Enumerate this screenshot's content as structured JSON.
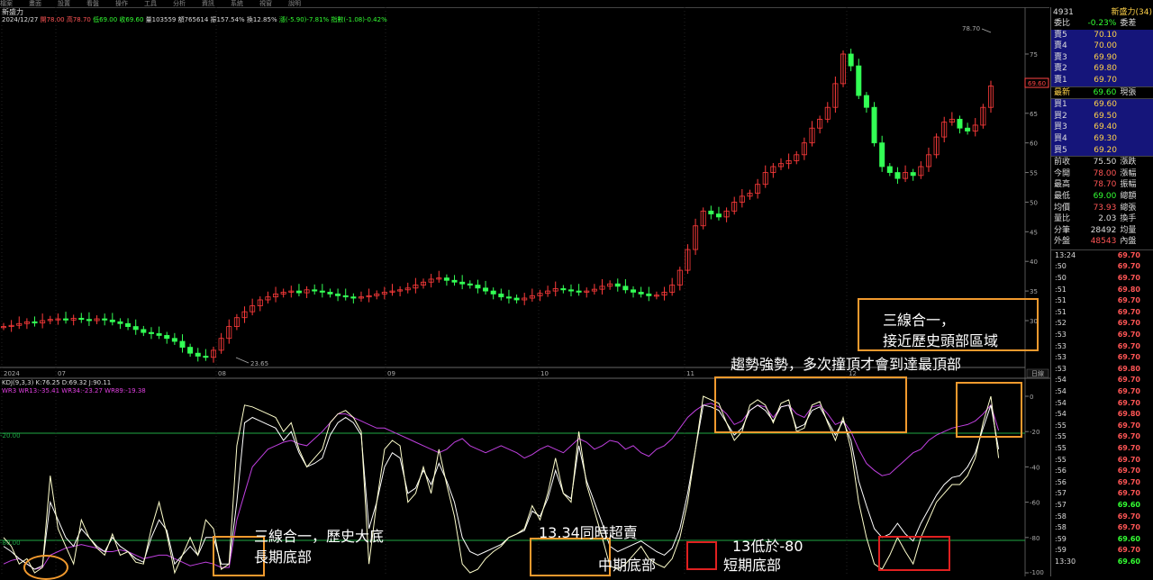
{
  "menu": [
    "檔案",
    "畫面",
    "設置",
    "看盤",
    "操作",
    "工具",
    "分析",
    "資訊",
    "系統",
    "視窗",
    "說明"
  ],
  "stock_title": "新盛力",
  "price_info": [
    {
      "text": "2024/12/27",
      "color": "w"
    },
    {
      "text": "開78.00",
      "color": "r"
    },
    {
      "text": "高78.70",
      "color": "r"
    },
    {
      "text": "低69.00",
      "color": "g"
    },
    {
      "text": "收69.60",
      "color": "g"
    },
    {
      "text": "量103559",
      "color": "w"
    },
    {
      "text": "額765614",
      "color": "w"
    },
    {
      "text": "振157.54%",
      "color": "w"
    },
    {
      "text": "換12.85%",
      "color": "w"
    },
    {
      "text": "漲(-5.90)-7.81%",
      "color": "g"
    },
    {
      "text": "指數(-1.08)-0.42%",
      "color": "g"
    }
  ],
  "kdj_line": "KDJ(9,3,3) K:76.25 D:69.32 J:90.11",
  "wr_line": "WR3 WR13:-35.41 WR34:-23.27 WR89:-19.38",
  "kline_max_label": "78.70",
  "kline_min_label": "23.65",
  "last_price_tag": "69.60",
  "price_axis": [
    "75",
    "70",
    "65",
    "60",
    "55",
    "50",
    "45",
    "40",
    "35",
    "30"
  ],
  "ind_axis": [
    "0",
    "-20",
    "-40",
    "-60",
    "-80",
    "-100"
  ],
  "ind_left_labels": [
    "-20.00",
    "-80.00"
  ],
  "date_axis": [
    "2024",
    "07",
    "08",
    "09",
    "10",
    "11",
    "12"
  ],
  "period_tab": "日線",
  "annotations": {
    "head_area": "三線合一，\n接近歷史頭部區域",
    "trend": "趨勢強勢，多次撞頂才會到達最頂部",
    "long_bottom": "三線合一，歷史大底\n長期底部",
    "mid_oversold": "13.34同時超賣",
    "mid_bottom": "中期底部",
    "short_cond": "13低於-80",
    "short_bottom": "短期底部"
  },
  "panel": {
    "code": "4931",
    "name": "新盛力",
    "name_suffix": "(34)",
    "ratio_label": "委比",
    "ratio_value": "-0.23%",
    "ratio_right": "委差",
    "asks": [
      {
        "label": "賣5",
        "value": "70.10"
      },
      {
        "label": "賣4",
        "value": "70.00"
      },
      {
        "label": "賣3",
        "value": "69.90"
      },
      {
        "label": "賣2",
        "value": "69.80"
      },
      {
        "label": "賣1",
        "value": "69.70"
      }
    ],
    "last": {
      "label": "最新",
      "value": "69.60",
      "right": "現張"
    },
    "bids": [
      {
        "label": "買1",
        "value": "69.60"
      },
      {
        "label": "買2",
        "value": "69.50"
      },
      {
        "label": "買3",
        "value": "69.40"
      },
      {
        "label": "買4",
        "value": "69.30"
      },
      {
        "label": "買5",
        "value": "69.20"
      }
    ],
    "stats": [
      {
        "label": "前收",
        "value": "75.50",
        "right": "漲跌",
        "color": "#ddd"
      },
      {
        "label": "今開",
        "value": "78.00",
        "right": "漲幅",
        "color": "#ff5555"
      },
      {
        "label": "最高",
        "value": "78.70",
        "right": "振幅",
        "color": "#ff5555"
      },
      {
        "label": "最低",
        "value": "69.00",
        "right": "總額",
        "color": "#33ff33"
      },
      {
        "label": "均價",
        "value": "73.93",
        "right": "總張",
        "color": "#ff5555"
      },
      {
        "label": "量比",
        "value": "2.03",
        "right": "換手",
        "color": "#ddd"
      },
      {
        "label": "分筆",
        "value": "28492",
        "right": "均量",
        "color": "#ddd"
      },
      {
        "label": "外盤",
        "value": "48543",
        "right": "內盤",
        "color": "#ff5555"
      }
    ],
    "ticks": [
      {
        "time": "13:24",
        "price": "69.70",
        "color": "#ff5555"
      },
      {
        "time": ":50",
        "price": "69.70",
        "color": "#ff5555"
      },
      {
        "time": ":50",
        "price": "69.70",
        "color": "#ff5555"
      },
      {
        "time": ":51",
        "price": "69.80",
        "color": "#ff5555"
      },
      {
        "time": ":51",
        "price": "69.70",
        "color": "#ff5555"
      },
      {
        "time": ":51",
        "price": "69.70",
        "color": "#ff5555"
      },
      {
        "time": ":52",
        "price": "69.70",
        "color": "#ff5555"
      },
      {
        "time": ":53",
        "price": "69.70",
        "color": "#ff5555"
      },
      {
        "time": ":53",
        "price": "69.70",
        "color": "#ff5555"
      },
      {
        "time": ":53",
        "price": "69.70",
        "color": "#ff5555"
      },
      {
        "time": ":53",
        "price": "69.80",
        "color": "#ff5555"
      },
      {
        "time": ":54",
        "price": "69.70",
        "color": "#ff5555"
      },
      {
        "time": ":54",
        "price": "69.70",
        "color": "#ff5555"
      },
      {
        "time": ":54",
        "price": "69.70",
        "color": "#ff5555"
      },
      {
        "time": ":54",
        "price": "69.80",
        "color": "#ff5555"
      },
      {
        "time": ":55",
        "price": "69.70",
        "color": "#ff5555"
      },
      {
        "time": ":55",
        "price": "69.70",
        "color": "#ff5555"
      },
      {
        "time": ":55",
        "price": "69.70",
        "color": "#ff5555"
      },
      {
        "time": ":55",
        "price": "69.70",
        "color": "#ff5555"
      },
      {
        "time": ":56",
        "price": "69.70",
        "color": "#ff5555"
      },
      {
        "time": ":56",
        "price": "69.70",
        "color": "#ff5555"
      },
      {
        "time": ":57",
        "price": "69.70",
        "color": "#ff5555"
      },
      {
        "time": ":57",
        "price": "69.60",
        "color": "#33ff33"
      },
      {
        "time": ":58",
        "price": "69.70",
        "color": "#ff5555"
      },
      {
        "time": ":58",
        "price": "69.70",
        "color": "#ff5555"
      },
      {
        "time": ":59",
        "price": "69.60",
        "color": "#33ff33"
      },
      {
        "time": ":59",
        "price": "69.70",
        "color": "#ff5555"
      },
      {
        "time": "13:30",
        "price": "69.60",
        "color": "#33ff33"
      }
    ]
  },
  "chart_data": {
    "type": "candlestick",
    "ylim": [
      22,
      82
    ],
    "price_series": [
      29,
      29.2,
      29.5,
      29.8,
      29.6,
      30,
      30.2,
      30.3,
      30.1,
      30.4,
      30.2,
      30,
      30.3,
      30.1,
      29.8,
      29.5,
      29,
      28.5,
      28,
      27.8,
      27.5,
      27,
      26.5,
      25.5,
      24.5,
      24,
      23.8,
      25,
      27,
      29,
      30.5,
      31.5,
      32.5,
      33.5,
      34,
      34.5,
      34.8,
      35,
      34.7,
      35.2,
      35,
      34.8,
      34.5,
      34.2,
      34,
      33.8,
      34,
      34.2,
      34.5,
      34.8,
      35,
      35.2,
      35.5,
      36,
      36.5,
      37,
      37.2,
      36.8,
      36.5,
      36.2,
      36,
      35.5,
      35,
      34.5,
      34,
      33.8,
      33.5,
      33.8,
      34.2,
      34.6,
      35,
      35.4,
      35.2,
      35,
      34.8,
      35,
      35.3,
      35.8,
      36.2,
      35.8,
      35.2,
      34.8,
      34.5,
      34.2,
      34.3,
      34.8,
      36,
      38.5,
      42,
      46,
      48.5,
      48,
      47.5,
      48.5,
      50,
      51,
      51.5,
      53,
      55,
      56,
      56.5,
      57,
      58,
      60,
      62.5,
      64,
      66,
      70,
      75,
      73,
      68,
      66,
      60,
      56,
      55,
      54,
      55,
      54.5,
      56,
      58,
      61,
      63.5,
      64,
      62.5,
      62,
      63,
      66,
      69.6
    ],
    "wr13": [
      -80,
      -85,
      -95,
      -92,
      -100,
      -97,
      -45,
      -75,
      -85,
      -95,
      -70,
      -80,
      -86,
      -90,
      -78,
      -90,
      -88,
      -94,
      -95,
      -75,
      -60,
      -78,
      -100,
      -90,
      -80,
      -90,
      -70,
      -75,
      -98,
      -95,
      -28,
      -5,
      -6,
      -8,
      -10,
      -12,
      -20,
      -15,
      -30,
      -40,
      -35,
      -30,
      -15,
      -10,
      -8,
      -12,
      -20,
      -95,
      -60,
      -30,
      -25,
      -28,
      -60,
      -55,
      -40,
      -55,
      -30,
      -50,
      -68,
      -95,
      -100,
      -98,
      -92,
      -88,
      -85,
      -80,
      -78,
      -75,
      -62,
      -70,
      -55,
      -35,
      -55,
      -60,
      -20,
      -50,
      -65,
      -80,
      -96,
      -98,
      -95,
      -90,
      -85,
      -92,
      -95,
      -97,
      -92,
      -80,
      -60,
      -30,
      0,
      -2,
      -4,
      -15,
      -25,
      -20,
      -5,
      -2,
      -5,
      -15,
      -4,
      -2,
      -20,
      -18,
      -5,
      -3,
      -15,
      -25,
      -12,
      -30,
      -60,
      -80,
      -95,
      -98,
      -90,
      -80,
      -88,
      -95,
      -80,
      -70,
      -60,
      -55,
      -50,
      -50,
      -45,
      -35,
      -15,
      0,
      -35
    ],
    "wr34": [
      -85,
      -88,
      -92,
      -95,
      -98,
      -96,
      -60,
      -70,
      -80,
      -85,
      -75,
      -80,
      -85,
      -88,
      -80,
      -85,
      -88,
      -92,
      -94,
      -80,
      -70,
      -76,
      -95,
      -90,
      -85,
      -90,
      -80,
      -80,
      -95,
      -95,
      -60,
      -15,
      -12,
      -14,
      -16,
      -18,
      -25,
      -20,
      -32,
      -40,
      -38,
      -35,
      -22,
      -15,
      -12,
      -15,
      -22,
      -75,
      -60,
      -40,
      -32,
      -35,
      -55,
      -52,
      -42,
      -50,
      -38,
      -48,
      -60,
      -80,
      -88,
      -90,
      -88,
      -86,
      -84,
      -80,
      -78,
      -76,
      -65,
      -68,
      -58,
      -42,
      -55,
      -58,
      -28,
      -48,
      -60,
      -72,
      -85,
      -88,
      -86,
      -84,
      -82,
      -85,
      -88,
      -90,
      -86,
      -75,
      -55,
      -30,
      -5,
      -6,
      -8,
      -15,
      -22,
      -18,
      -8,
      -5,
      -8,
      -14,
      -6,
      -5,
      -18,
      -16,
      -8,
      -6,
      -14,
      -22,
      -14,
      -25,
      -48,
      -62,
      -75,
      -80,
      -78,
      -72,
      -78,
      -82,
      -72,
      -64,
      -56,
      -50,
      -46,
      -45,
      -40,
      -32,
      -18,
      -5,
      -30
    ],
    "wr89": [
      -95,
      -93,
      -92,
      -95,
      -98,
      -97,
      -90,
      -88,
      -86,
      -85,
      -84,
      -85,
      -86,
      -88,
      -88,
      -87,
      -88,
      -90,
      -92,
      -91,
      -90,
      -90,
      -92,
      -94,
      -96,
      -95,
      -94,
      -95,
      -97,
      -97,
      -70,
      -55,
      -40,
      -35,
      -30,
      -28,
      -26,
      -25,
      -27,
      -28,
      -24,
      -20,
      -15,
      -10,
      -10,
      -12,
      -14,
      -16,
      -18,
      -18,
      -20,
      -22,
      -24,
      -26,
      -28,
      -30,
      -32,
      -30,
      -26,
      -24,
      -28,
      -30,
      -32,
      -30,
      -28,
      -30,
      -32,
      -35,
      -33,
      -30,
      -28,
      -30,
      -32,
      -28,
      -24,
      -26,
      -30,
      -28,
      -25,
      -26,
      -30,
      -28,
      -32,
      -34,
      -30,
      -28,
      -24,
      -18,
      -12,
      -8,
      -5,
      -4,
      -6,
      -10,
      -16,
      -14,
      -8,
      -5,
      -6,
      -12,
      -6,
      -5,
      -10,
      -12,
      -6,
      -5,
      -10,
      -16,
      -14,
      -20,
      -30,
      -38,
      -42,
      -45,
      -44,
      -40,
      -36,
      -32,
      -30,
      -25,
      -22,
      -20,
      -18,
      -17,
      -16,
      -14,
      -10,
      -5,
      -19.38
    ]
  }
}
